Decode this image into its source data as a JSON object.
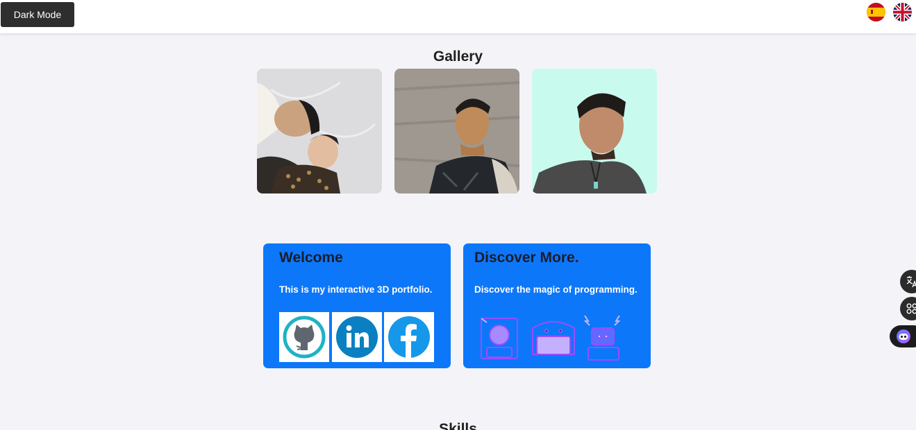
{
  "header": {
    "dark_mode_label": "Dark Mode",
    "languages": [
      {
        "icon": "spain-flag-icon",
        "code": "es"
      },
      {
        "icon": "uk-flag-icon",
        "code": "en"
      }
    ]
  },
  "gallery": {
    "title": "Gallery",
    "photos": [
      {
        "icon": "photo-family"
      },
      {
        "icon": "photo-portrait-illustrated"
      },
      {
        "icon": "photo-portrait-mint"
      }
    ]
  },
  "cards": [
    {
      "title": "Welcome",
      "text": "This is my interactive 3D portfolio.",
      "links": [
        {
          "icon": "github-icon"
        },
        {
          "icon": "linkedin-icon"
        },
        {
          "icon": "facebook-icon"
        }
      ]
    },
    {
      "title": "Discover More.",
      "text": "Discover the magic of programming.",
      "icons": [
        "robot-astronaut-icon",
        "robot-laptop-icon",
        "robot-electric-icon"
      ]
    }
  ],
  "skills": {
    "title": "Skills"
  },
  "floating": {
    "translate_icon": "translate-icon",
    "apps_icon": "apps-grid-icon",
    "assistant_icon": "assistant-face-icon"
  },
  "colors": {
    "accent": "#0d77fa",
    "page_bg": "#f4f3f8",
    "button_dark": "#2e2e2e"
  }
}
